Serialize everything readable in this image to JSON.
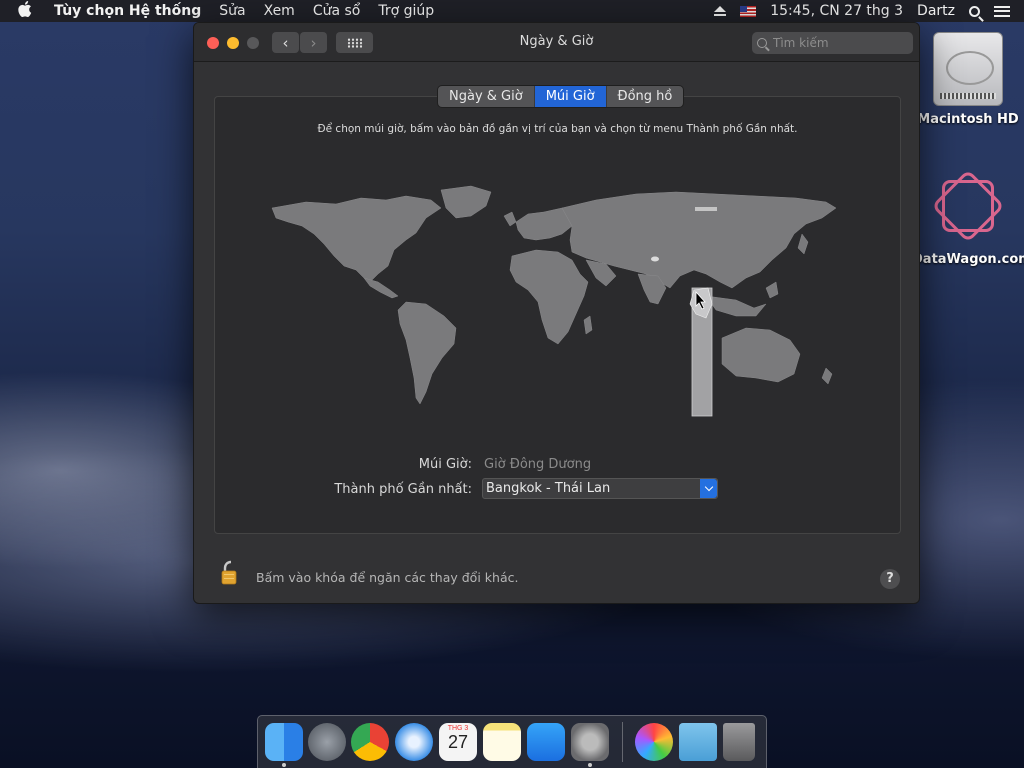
{
  "menubar": {
    "app_name": "Tùy chọn Hệ thống",
    "menus": [
      "Sửa",
      "Xem",
      "Cửa sổ",
      "Trợ giúp"
    ],
    "clock": "15:45, CN 27 thg 3",
    "user": "Dartz",
    "icons": [
      "apple-logo",
      "eject-icon",
      "us-flag-input-icon",
      "spotlight-search-icon",
      "notification-center-icon"
    ]
  },
  "desktop": {
    "icons": [
      {
        "label": "Macintosh HD",
        "icon": "hard-disk-icon"
      },
      {
        "label": "DataWagon.com",
        "icon": "disk-image-icon"
      }
    ]
  },
  "window": {
    "title": "Ngày & Giờ",
    "search_placeholder": "Tìm kiếm",
    "tabs": [
      {
        "label": "Ngày & Giờ",
        "active": false
      },
      {
        "label": "Múi Giờ",
        "active": true
      },
      {
        "label": "Đồng hồ",
        "active": false
      }
    ],
    "instruction": "Để chọn múi giờ, bấm vào bản đồ gần vị trí của bạn và chọn từ menu Thành phố Gần nhất.",
    "timezone_label": "Múi Giờ:",
    "timezone_value": "Giờ Đông Dương",
    "city_label": "Thành phố Gần nhất:",
    "city_value": "Bangkok - Thái Lan",
    "lock_text": "Bấm vào khóa để ngăn các thay đổi khác.",
    "help_label": "?"
  },
  "colors": {
    "accent": "#2265d6",
    "window_bg": "#323234",
    "map_land": "#7a7a7c",
    "timezone_highlight": "#9c9c9e"
  },
  "dock": {
    "apps": [
      "finder-icon",
      "launchpad-icon",
      "chrome-icon",
      "safari-icon",
      "calendar-icon",
      "notes-icon",
      "app-store-icon",
      "system-preferences-icon",
      "photos-icon",
      "downloads-folder-icon",
      "trash-icon"
    ],
    "calendar_day": "27",
    "calendar_month": "THG 3"
  }
}
